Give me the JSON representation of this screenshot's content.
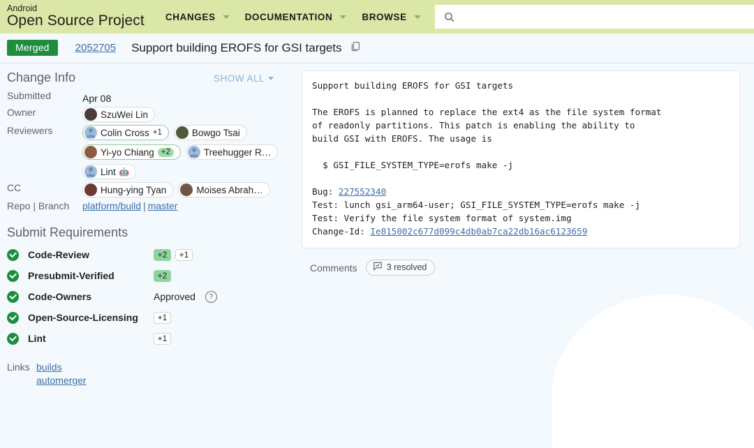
{
  "header": {
    "brand_line1": "Android",
    "brand_line2": "Open Source Project",
    "nav": [
      {
        "label": "CHANGES",
        "has_caret": true
      },
      {
        "label": "DOCUMENTATION",
        "has_caret": true
      },
      {
        "label": "BROWSE",
        "has_caret": true
      }
    ],
    "search_placeholder": "",
    "search_value": "",
    "search_icon": "search-icon",
    "bar_color": "#dbe7a6"
  },
  "change_header": {
    "status": "Merged",
    "status_color": "#1e8e3e",
    "number": "2052705",
    "subject": "Support building EROFS for GSI targets",
    "copy_icon": "copy-icon"
  },
  "change_info": {
    "title": "Change Info",
    "show_all": "SHOW ALL",
    "labels": {
      "submitted": "Submitted",
      "owner": "Owner",
      "reviewers": "Reviewers",
      "cc": "CC",
      "repo_branch": "Repo | Branch"
    },
    "submitted_value": "Apr 08",
    "owner": {
      "name": "SzuWei Lin",
      "avatar": "photo"
    },
    "reviewers": [
      {
        "name": "Colin Cross",
        "vote": "+1",
        "vote_style": "plain",
        "avatar": "person",
        "voted": true
      },
      {
        "name": "Bowgo Tsai",
        "vote": "",
        "vote_style": "",
        "avatar": "photo",
        "voted": false
      },
      {
        "name": "Yi-yo Chiang",
        "vote": "+2",
        "vote_style": "pill",
        "avatar": "photo",
        "voted": true
      },
      {
        "name": "Treehugger R…",
        "vote": "",
        "vote_style": "",
        "avatar": "person",
        "voted": false
      },
      {
        "name": "Lint",
        "vote": "🤖",
        "vote_style": "plain",
        "avatar": "person",
        "voted": false
      }
    ],
    "cc": [
      {
        "name": "Hung-ying Tyan",
        "avatar": "photo"
      },
      {
        "name": "Moises Abrah…",
        "avatar": "photo"
      }
    ],
    "repo": "platform/build",
    "branch": "master",
    "repo_separator": "|"
  },
  "submit_requirements": {
    "title": "Submit Requirements",
    "rows": [
      {
        "name": "Code-Review",
        "status": "ok",
        "values": [
          {
            "text": "+2",
            "filled": true
          },
          {
            "text": "+1",
            "filled": false
          }
        ],
        "text_value": "",
        "has_help": false
      },
      {
        "name": "Presubmit-Verified",
        "status": "ok",
        "values": [
          {
            "text": "+2",
            "filled": true
          }
        ],
        "text_value": "",
        "has_help": false
      },
      {
        "name": "Code-Owners",
        "status": "ok",
        "values": [],
        "text_value": "Approved",
        "has_help": true
      },
      {
        "name": "Open-Source-Licensing",
        "status": "ok",
        "values": [
          {
            "text": "+1",
            "filled": false
          }
        ],
        "text_value": "",
        "has_help": false
      },
      {
        "name": "Lint",
        "status": "ok",
        "values": [
          {
            "text": "+1",
            "filled": false
          }
        ],
        "text_value": "",
        "has_help": false
      }
    ]
  },
  "links": {
    "label": "Links",
    "items": [
      "builds",
      "automerger"
    ]
  },
  "commit_message": {
    "subject": "Support building EROFS for GSI targets",
    "body_1": "The EROFS is planned to replace the ext4 as the file system format\nof readonly partitions. This patch is enabling the ability to\nbuild GSI with EROFS. The usage is",
    "command": "  $ GSI_FILE_SYSTEM_TYPE=erofs make -j",
    "bug_label": "Bug: ",
    "bug_id": "227552340",
    "test_1": "Test: lunch gsi_arm64-user; GSI_FILE_SYSTEM_TYPE=erofs make -j",
    "test_2": "Test: Verify the file system format of system.img",
    "change_id_label": "Change-Id: ",
    "change_id": "Ie815002c677d099c4db0ab7ca22db16ac6123659"
  },
  "comments": {
    "label": "Comments",
    "pill_text": "3 resolved",
    "pill_icon": "comment-icon"
  }
}
